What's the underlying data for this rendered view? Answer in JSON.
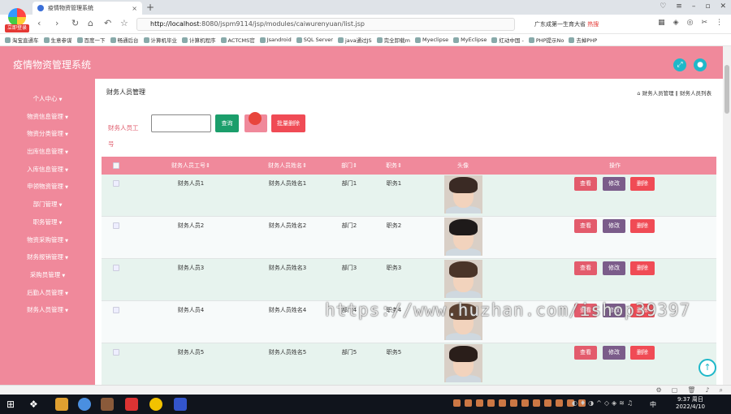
{
  "browser": {
    "tab_title": "疫情物资管理系统",
    "url_host": "http://localhost",
    "url_rest": ":8080/jspm9114/jsp/modules/caiwurenyuan/list.jsp",
    "search_text": "广东成第一生育大省",
    "search_hot": "热搜",
    "logo_label": "立即登录",
    "bookmarks": [
      "淘宝直通车",
      "生意参谋",
      "百度一下",
      "畅通后台",
      "计算机毕业",
      "计算机程序",
      "ACTCMS官",
      "Jsandroid",
      "SQL Server",
      "java通过JS",
      "完全卸载m",
      "Myeclipse",
      "MyEclipse",
      "红动中国 -",
      "PHP提示No",
      "去掉PHP"
    ]
  },
  "app": {
    "title": "疫情物资管理系统",
    "sidebar": [
      {
        "label": "个人中心",
        "arrow": true
      },
      {
        "label": "物资信息管理",
        "arrow": true
      },
      {
        "label": "物资分类管理",
        "arrow": true
      },
      {
        "label": "出库信息管理",
        "arrow": true
      },
      {
        "label": "入库信息管理",
        "arrow": true
      },
      {
        "label": "申领物资管理",
        "arrow": true
      },
      {
        "label": "部门管理",
        "arrow": true
      },
      {
        "label": "职务管理",
        "arrow": true
      },
      {
        "label": "物资采购管理",
        "arrow": true
      },
      {
        "label": "财务报销管理",
        "arrow": true
      },
      {
        "label": "采购员管理",
        "arrow": true
      },
      {
        "label": "后勤人员管理",
        "arrow": true
      },
      {
        "label": "财务人员管理",
        "arrow": true
      }
    ],
    "page_title": "财务人员管理",
    "breadcrumb": "财务人员管理 ‖ 财务人员列表",
    "filter_label": "财务人员工号",
    "filter_value": "",
    "query_label": "查询",
    "batch_delete_label": "批量删除",
    "table": {
      "headers": [
        "财务人员工号",
        "财务人员姓名",
        "部门",
        "职务",
        "头像",
        "操作"
      ],
      "sort_mark": "⇕",
      "rows": [
        {
          "id": "财务人员1",
          "name": "财务人员姓名1",
          "dept": "部门1",
          "job": "职务1"
        },
        {
          "id": "财务人员2",
          "name": "财务人员姓名2",
          "dept": "部门2",
          "job": "职务2"
        },
        {
          "id": "财务人员3",
          "name": "财务人员姓名3",
          "dept": "部门3",
          "job": "职务3"
        },
        {
          "id": "财务人员4",
          "name": "财务人员姓名4",
          "dept": "部门4",
          "job": "职务4"
        },
        {
          "id": "财务人员5",
          "name": "财务人员姓名5",
          "dept": "部门5",
          "job": "职务5"
        }
      ],
      "view_label": "查看",
      "edit_label": "修改",
      "delete_label": "删除"
    },
    "watermark": "https://www.huzhan.com/ishop39397"
  },
  "taskbar": {
    "time": "9:37 周日",
    "date": "2022/4/10",
    "lang": "中"
  },
  "colors": {
    "primary_pink": "#f0899b",
    "query_green": "#1b9e6b",
    "delete_red": "#f04b55",
    "edit_purple": "#7b5c8a",
    "accent_cyan": "#1fb8c9"
  }
}
